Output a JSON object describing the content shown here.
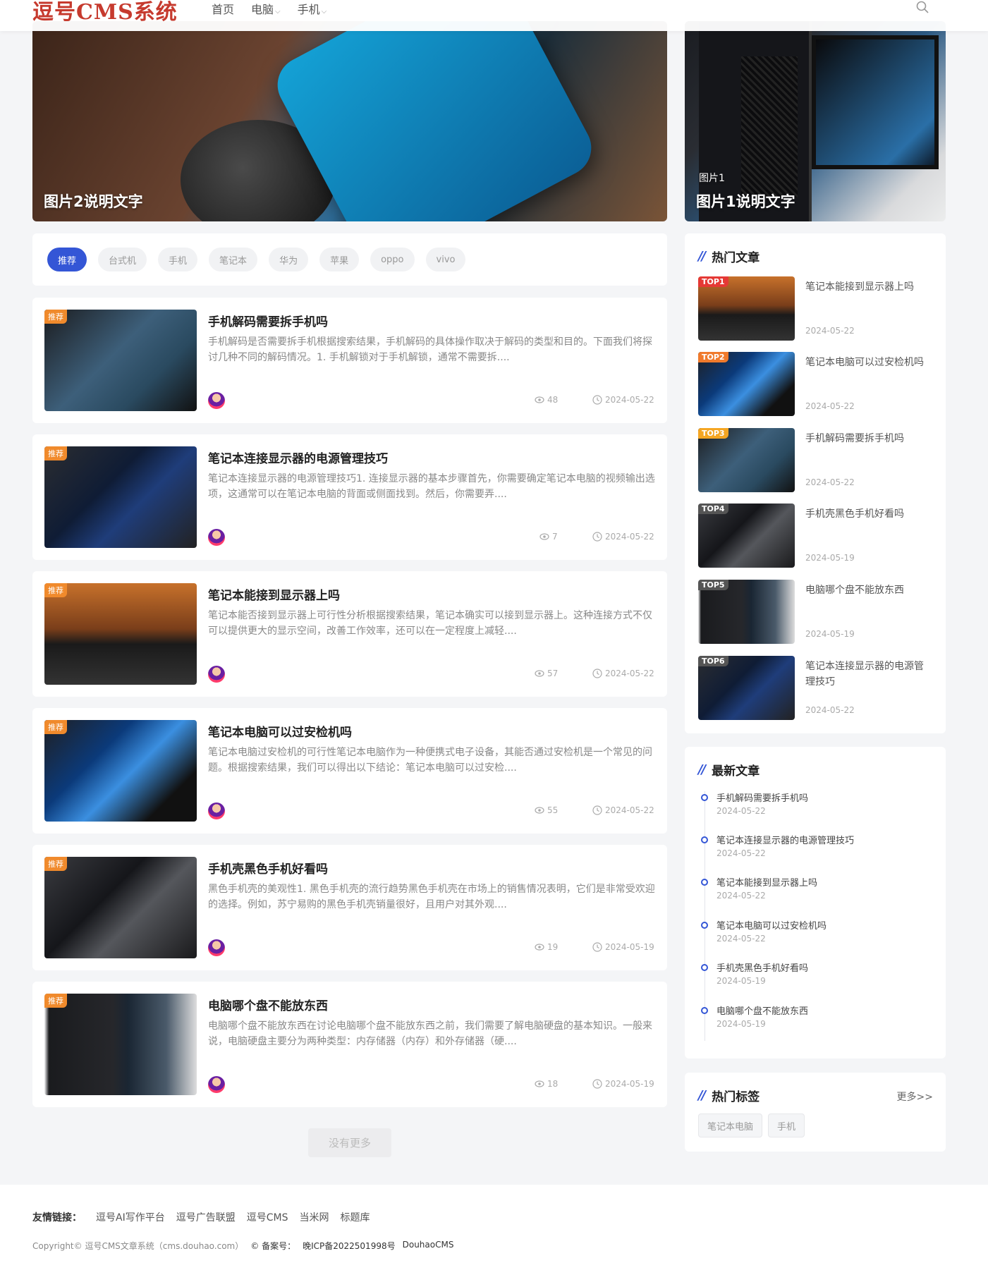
{
  "header": {
    "logo": "逗号CMS系统",
    "nav": [
      {
        "label": "首页",
        "active": true,
        "dropdown": false
      },
      {
        "label": "电脑",
        "active": false,
        "dropdown": true
      },
      {
        "label": "手机",
        "active": false,
        "dropdown": true
      }
    ],
    "search_icon": "search-icon"
  },
  "banners": {
    "main": {
      "caption": "图片2说明文字"
    },
    "side": {
      "subtitle": "图片1",
      "caption": "图片1说明文字"
    }
  },
  "category_tabs": [
    "推荐",
    "台式机",
    "手机",
    "笔记本",
    "华为",
    "苹果",
    "oppo",
    "vivo"
  ],
  "articles": [
    {
      "badge": "推荐",
      "title": "手机解码需要拆手机吗",
      "desc": "手机解码是否需要拆手机根据搜索结果，手机解码的具体操作取决于解码的类型和目的。下面我们将探讨几种不同的解码情况。1. 手机解锁对于手机解锁，通常不需要拆....",
      "views": "48",
      "date": "2024-05-22"
    },
    {
      "badge": "推荐",
      "title": "笔记本连接显示器的电源管理技巧",
      "desc": "笔记本连接显示器的电源管理技巧1. 连接显示器的基本步骤首先，你需要确定笔记本电脑的视频输出选项，这通常可以在笔记本电脑的背面或侧面找到。然后，你需要弄....",
      "views": "7",
      "date": "2024-05-22"
    },
    {
      "badge": "推荐",
      "title": "笔记本能接到显示器上吗",
      "desc": "笔记本能否接到显示器上可行性分析根据搜索结果，笔记本确实可以接到显示器上。这种连接方式不仅可以提供更大的显示空间，改善工作效率，还可以在一定程度上减轻....",
      "views": "57",
      "date": "2024-05-22"
    },
    {
      "badge": "推荐",
      "title": "笔记本电脑可以过安检机吗",
      "desc": "笔记本电脑过安检机的可行性笔记本电脑作为一种便携式电子设备，其能否通过安检机是一个常见的问题。根据搜索结果，我们可以得出以下结论：笔记本电脑可以过安检....",
      "views": "55",
      "date": "2024-05-22"
    },
    {
      "badge": "推荐",
      "title": "手机壳黑色手机好看吗",
      "desc": "黑色手机壳的美观性1. 黑色手机壳的流行趋势黑色手机壳在市场上的销售情况表明，它们是非常受欢迎的选择。例如，苏宁易购的黑色手机壳销量很好，且用户对其外观....",
      "views": "19",
      "date": "2024-05-19"
    },
    {
      "badge": "推荐",
      "title": "电脑哪个盘不能放东西",
      "desc": "电脑哪个盘不能放东西在讨论电脑哪个盘不能放东西之前，我们需要了解电脑硬盘的基本知识。一般来说，电脑硬盘主要分为两种类型：内存储器（内存）和外存储器（硬....",
      "views": "18",
      "date": "2024-05-19"
    }
  ],
  "load_more": "没有更多",
  "hot": {
    "title": "热门文章",
    "items": [
      {
        "rank": "TOP1",
        "title": "笔记本能接到显示器上吗",
        "date": "2024-05-22",
        "color": "#e53935"
      },
      {
        "rank": "TOP2",
        "title": "笔记本电脑可以过安检机吗",
        "date": "2024-05-22",
        "color": "#f07a2c"
      },
      {
        "rank": "TOP3",
        "title": "手机解码需要拆手机吗",
        "date": "2024-05-22",
        "color": "#f5a623"
      },
      {
        "rank": "TOP4",
        "title": "手机壳黑色手机好看吗",
        "date": "2024-05-19",
        "color": "#555555"
      },
      {
        "rank": "TOP5",
        "title": "电脑哪个盘不能放东西",
        "date": "2024-05-19",
        "color": "#555555"
      },
      {
        "rank": "TOP6",
        "title": "笔记本连接显示器的电源管理技巧",
        "date": "2024-05-22",
        "color": "#555555"
      }
    ]
  },
  "latest": {
    "title": "最新文章",
    "items": [
      {
        "title": "手机解码需要拆手机吗",
        "date": "2024-05-22"
      },
      {
        "title": "笔记本连接显示器的电源管理技巧",
        "date": "2024-05-22"
      },
      {
        "title": "笔记本能接到显示器上吗",
        "date": "2024-05-22"
      },
      {
        "title": "笔记本电脑可以过安检机吗",
        "date": "2024-05-22"
      },
      {
        "title": "手机壳黑色手机好看吗",
        "date": "2024-05-19"
      },
      {
        "title": "电脑哪个盘不能放东西",
        "date": "2024-05-19"
      }
    ]
  },
  "tags": {
    "title": "热门标签",
    "more": "更多>>",
    "items": [
      "笔记本电脑",
      "手机"
    ]
  },
  "footer": {
    "friend_label": "友情链接：",
    "links": [
      "逗号AI写作平台",
      "逗号广告联盟",
      "逗号CMS",
      "当米网",
      "标题库"
    ],
    "copyright": "Copyright© 逗号CMS文章系统（cms.douhao.com）",
    "beian_label": "© 备案号：",
    "beian": "晚ICP备2022501998号",
    "powered": "DouhaoCMS"
  }
}
